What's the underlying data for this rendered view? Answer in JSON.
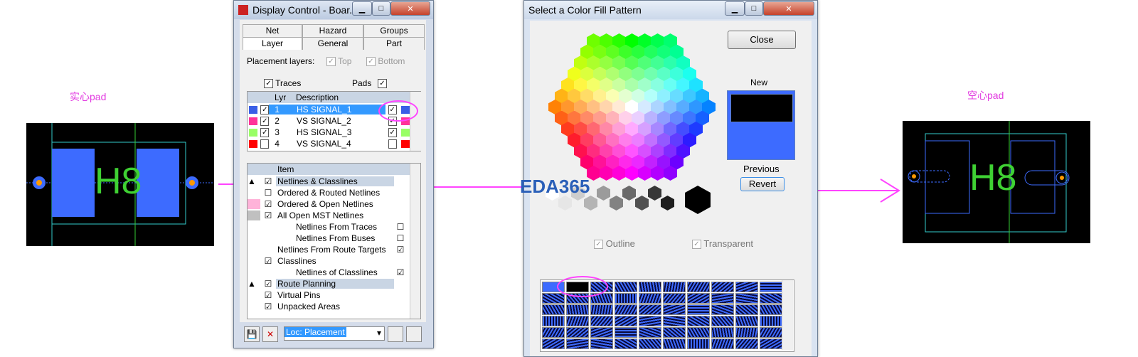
{
  "left_label": "实心pad",
  "right_label": "空心pad",
  "pcb_text": "H8",
  "colors": {
    "pad_blue": "#3d6bff",
    "text_green": "#3fd133",
    "outline_cyan": "#33cccc",
    "magenta": "#ff44ff",
    "pin_orange": "#ff9900"
  },
  "display_control": {
    "title": "Display Control - Boar...",
    "tabs_row1": [
      "Net",
      "Hazard",
      "Groups"
    ],
    "tabs_row2": [
      "Layer",
      "General",
      "Part"
    ],
    "placement_layers_label": "Placement layers:",
    "top_label": "Top",
    "bottom_label": "Bottom",
    "traces_label": "Traces",
    "pads_label": "Pads",
    "layer_headers": {
      "lyr": "Lyr",
      "description": "Description"
    },
    "layers": [
      {
        "num": "1",
        "desc": "HS SIGNAL_1",
        "color": "#3a5fe6",
        "selected": true
      },
      {
        "num": "2",
        "desc": "VS SIGNAL_2",
        "color": "#ff3399",
        "selected": false
      },
      {
        "num": "3",
        "desc": "HS SIGNAL_3",
        "color": "#99ff66",
        "selected": false
      },
      {
        "num": "4",
        "desc": "VS SIGNAL_4",
        "color": "#ff0000",
        "selected": false
      }
    ],
    "item_header": "Item",
    "items": [
      {
        "label": "Netlines & Classlines",
        "indent": 0,
        "hl": true,
        "swatch": "",
        "arrow": true,
        "c1": "☑",
        "c2": ""
      },
      {
        "label": "Ordered & Routed Netlines",
        "indent": 0,
        "hl": false,
        "swatch": "",
        "arrow": false,
        "c1": "☐",
        "c2": ""
      },
      {
        "label": "Ordered & Open Netlines",
        "indent": 0,
        "hl": false,
        "swatch": "#ffb3d9",
        "arrow": false,
        "c1": "☑",
        "c2": ""
      },
      {
        "label": "All Open MST Netlines",
        "indent": 0,
        "hl": false,
        "swatch": "#c0c0c0",
        "arrow": false,
        "c1": "☑",
        "c2": ""
      },
      {
        "label": "Netlines From Traces",
        "indent": 1,
        "hl": false,
        "swatch": "",
        "arrow": false,
        "c1": "",
        "c2": "☐"
      },
      {
        "label": "Netlines From Buses",
        "indent": 1,
        "hl": false,
        "swatch": "",
        "arrow": false,
        "c1": "",
        "c2": "☐"
      },
      {
        "label": "Netlines From Route Targets",
        "indent": 0,
        "hl": false,
        "swatch": "",
        "arrow": false,
        "c1": "",
        "c2": "☑"
      },
      {
        "label": "Classlines",
        "indent": 0,
        "hl": false,
        "swatch": "",
        "arrow": false,
        "c1": "☑",
        "c2": ""
      },
      {
        "label": "Netlines of Classlines",
        "indent": 1,
        "hl": false,
        "swatch": "",
        "arrow": false,
        "c1": "",
        "c2": "☑"
      },
      {
        "label": "Route Planning",
        "indent": 0,
        "hl": true,
        "swatch": "",
        "arrow": true,
        "c1": "☑",
        "c2": ""
      },
      {
        "label": "Virtual Pins",
        "indent": 0,
        "hl": false,
        "swatch": "",
        "arrow": false,
        "c1": "☑",
        "c2": ""
      },
      {
        "label": "Unpacked Areas",
        "indent": 0,
        "hl": false,
        "swatch": "",
        "arrow": false,
        "c1": "☑",
        "c2": ""
      }
    ],
    "scheme": "Loc: Placement"
  },
  "color_dialog": {
    "title": "Select a Color Fill Pattern",
    "close_label": "Close",
    "new_label": "New",
    "previous_label": "Previous",
    "revert_label": "Revert",
    "outline_label": "Outline",
    "transparent_label": "Transparent",
    "new_color": "#000000",
    "previous_color": "#3d6bff",
    "watermark": "EDA365"
  }
}
